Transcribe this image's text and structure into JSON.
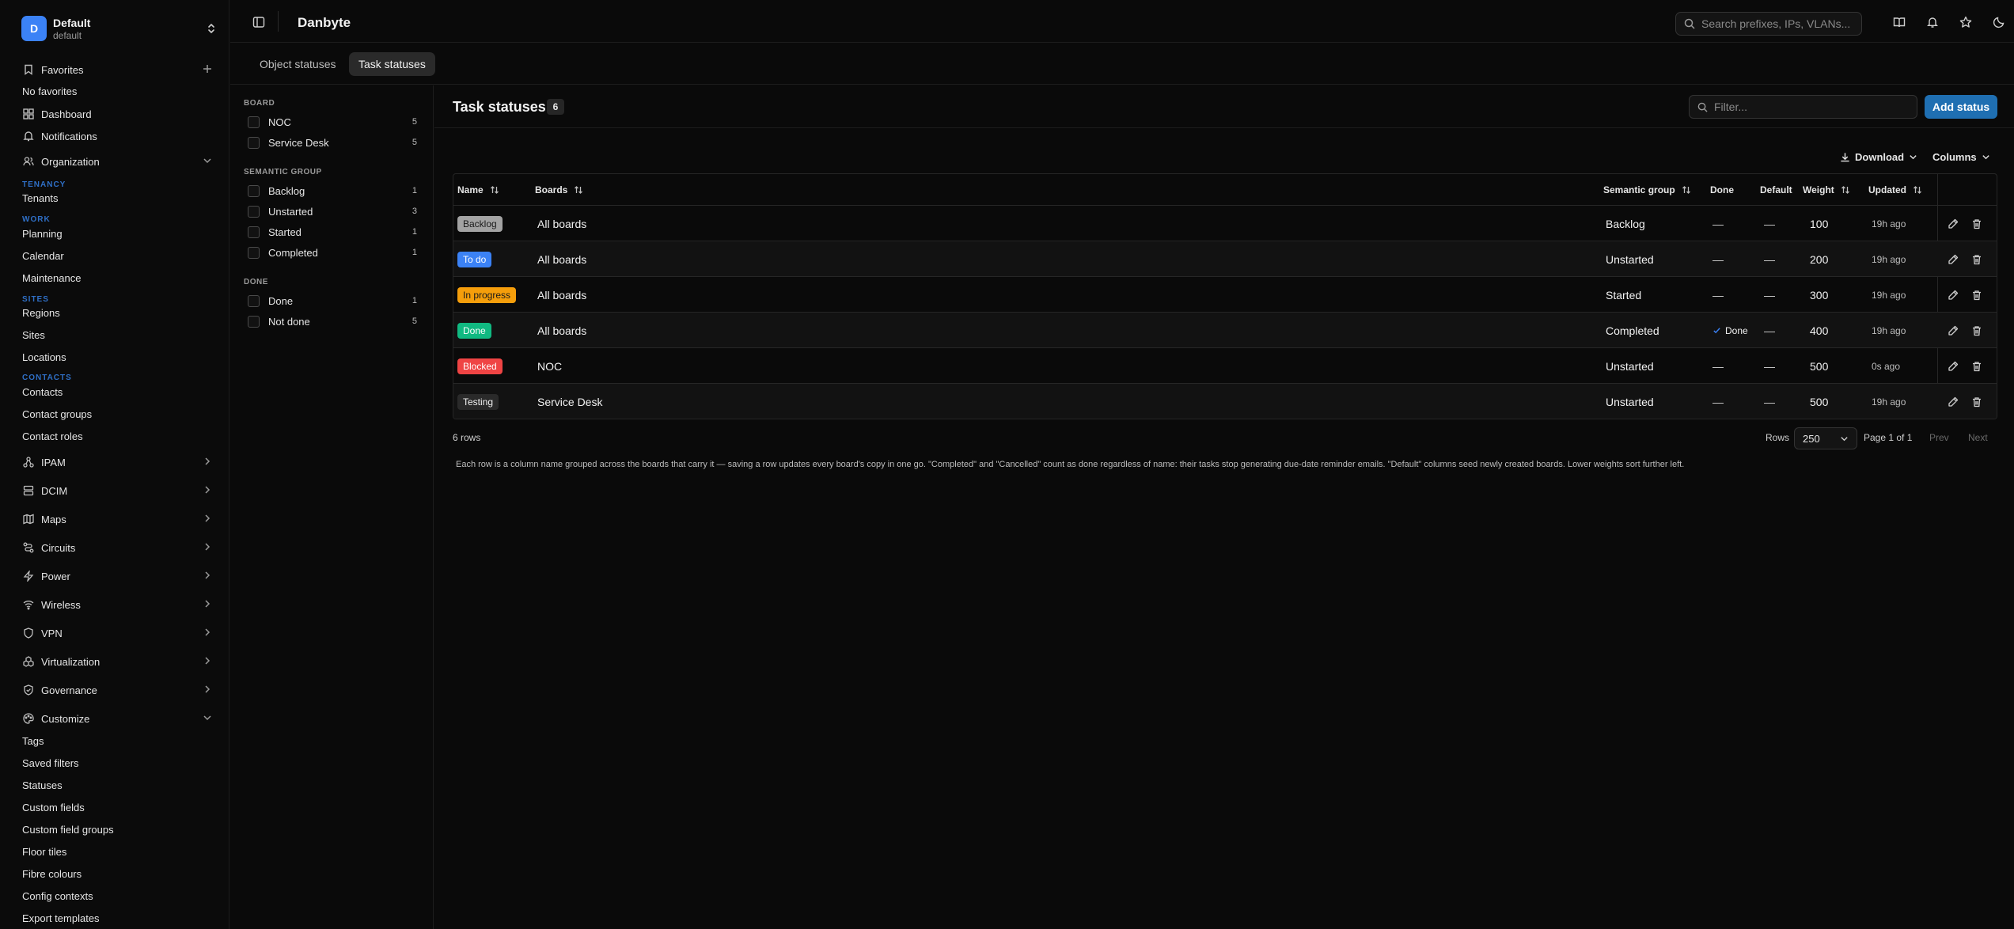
{
  "workspace": {
    "initial": "D",
    "name": "Default",
    "slug": "default"
  },
  "sidebar": {
    "favorites_label": "Favorites",
    "no_favorites": "No favorites",
    "dashboard": "Dashboard",
    "notifications": "Notifications",
    "organization": "Organization",
    "sections": {
      "tenancy": "TENANCY",
      "work": "WORK",
      "sites": "SITES",
      "contacts": "CONTACTS"
    },
    "tenants": "Tenants",
    "planning": "Planning",
    "calendar": "Calendar",
    "maintenance": "Maintenance",
    "regions": "Regions",
    "sites": "Sites",
    "locations": "Locations",
    "contacts": "Contacts",
    "contact_groups": "Contact groups",
    "contact_roles": "Contact roles",
    "groups": [
      "IPAM",
      "DCIM",
      "Maps",
      "Circuits",
      "Power",
      "Wireless",
      "VPN",
      "Virtualization",
      "Governance"
    ],
    "customize": "Customize",
    "customize_items": [
      "Tags",
      "Saved filters",
      "Statuses",
      "Custom fields",
      "Custom field groups",
      "Floor tiles",
      "Fibre colours",
      "Config contexts",
      "Export templates"
    ]
  },
  "header": {
    "title": "Danbyte",
    "search_placeholder": "Search prefixes, IPs, VLANs..."
  },
  "tabs": [
    "Object statuses",
    "Task statuses"
  ],
  "filters": {
    "board": {
      "heading": "BOARD",
      "items": [
        {
          "label": "NOC",
          "count": "5"
        },
        {
          "label": "Service Desk",
          "count": "5"
        }
      ]
    },
    "semantic": {
      "heading": "SEMANTIC GROUP",
      "items": [
        {
          "label": "Backlog",
          "count": "1"
        },
        {
          "label": "Unstarted",
          "count": "3"
        },
        {
          "label": "Started",
          "count": "1"
        },
        {
          "label": "Completed",
          "count": "1"
        }
      ]
    },
    "done": {
      "heading": "DONE",
      "items": [
        {
          "label": "Done",
          "count": "1"
        },
        {
          "label": "Not done",
          "count": "5"
        }
      ]
    }
  },
  "main": {
    "title": "Task statuses",
    "count": "6",
    "filter_placeholder": "Filter...",
    "add_button": "Add status",
    "download": "Download",
    "columns": "Columns",
    "headers": {
      "name": "Name",
      "boards": "Boards",
      "semantic": "Semantic group",
      "done": "Done",
      "default": "Default",
      "weight": "Weight",
      "updated": "Updated"
    },
    "rows": [
      {
        "name": "Backlog",
        "color": "#a3a3a3",
        "text_color": "#1a1a1a",
        "boards": "All boards",
        "semantic": "Backlog",
        "done": "—",
        "default": "—",
        "weight": "100",
        "updated": "19h ago"
      },
      {
        "name": "To do",
        "color": "#3b82f6",
        "text_color": "#ffffff",
        "boards": "All boards",
        "semantic": "Unstarted",
        "done": "—",
        "default": "—",
        "weight": "200",
        "updated": "19h ago"
      },
      {
        "name": "In progress",
        "color": "#f59e0b",
        "text_color": "#1a1a1a",
        "boards": "All boards",
        "semantic": "Started",
        "done": "—",
        "default": "—",
        "weight": "300",
        "updated": "19h ago"
      },
      {
        "name": "Done",
        "color": "#10b981",
        "text_color": "#ffffff",
        "boards": "All boards",
        "semantic": "Completed",
        "done": "Done",
        "default": "—",
        "weight": "400",
        "updated": "19h ago"
      },
      {
        "name": "Blocked",
        "color": "#ef4444",
        "text_color": "#ffffff",
        "boards": "NOC",
        "semantic": "Unstarted",
        "done": "—",
        "default": "—",
        "weight": "500",
        "updated": "0s ago"
      },
      {
        "name": "Testing",
        "color": "#2a2a2a",
        "text_color": "#f2f2f2",
        "boards": "Service Desk",
        "semantic": "Unstarted",
        "done": "—",
        "default": "—",
        "weight": "500",
        "updated": "19h ago"
      }
    ],
    "row_count": "6 rows",
    "pager": {
      "rows_label": "Rows",
      "page_size": "250",
      "page_info": "Page 1 of 1",
      "prev": "Prev",
      "next": "Next"
    },
    "note": "Each row is a column name grouped across the boards that carry it — saving a row updates every board's copy in one go. \"Completed\" and \"Cancelled\" count as done regardless of name: their tasks stop generating due-date reminder emails. \"Default\" columns seed newly created boards. Lower weights sort further left."
  }
}
